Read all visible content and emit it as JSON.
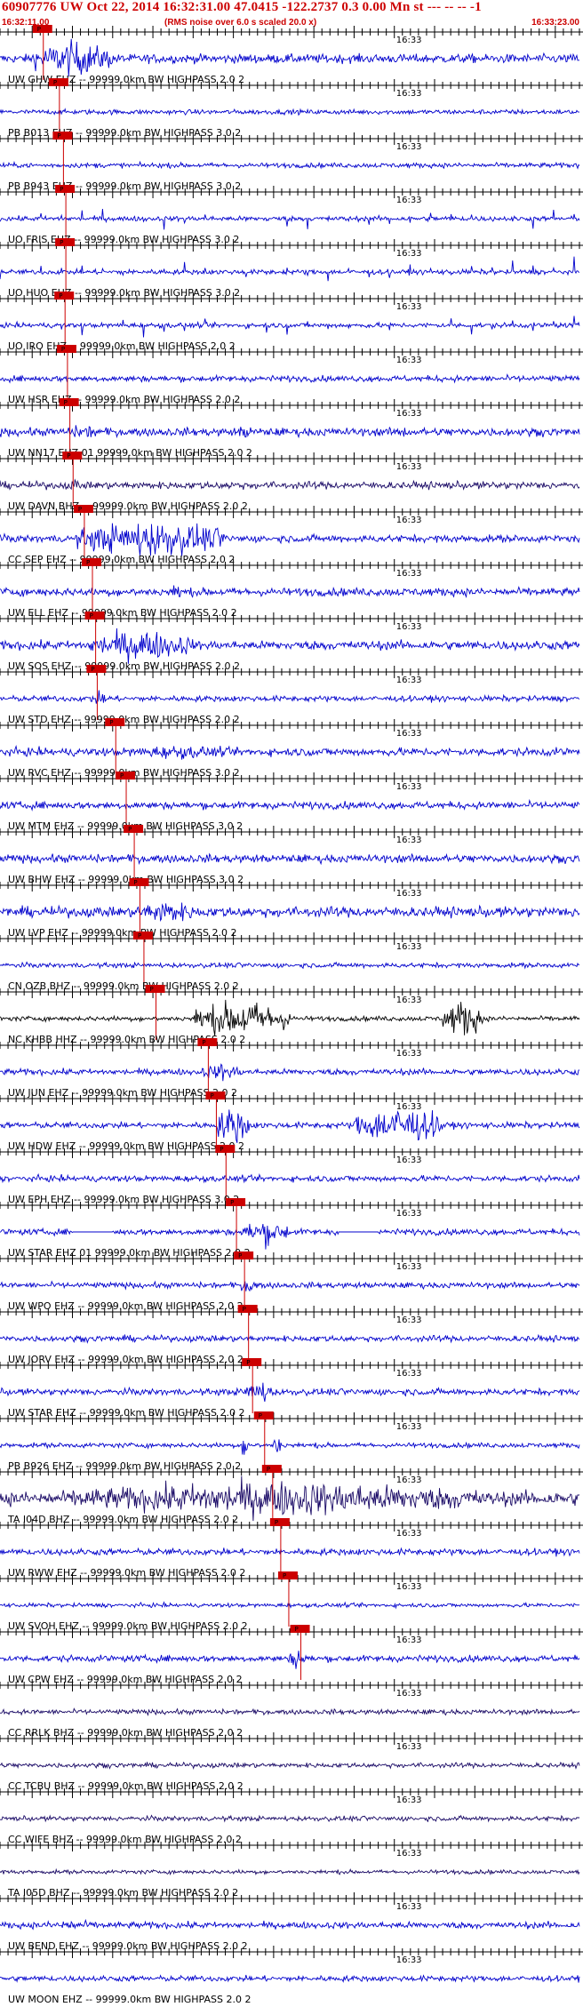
{
  "header": {
    "title": "60907776 UW Oct 22, 2014 16:32:31.00   47.0415 -122.2737  0.3 0.00 Mn st --- -- --   -1",
    "time_left": "16:32:11.00",
    "note": "(RMS noise over 6.0 s scaled 20.0 x)",
    "time_right": "16:33:23.00"
  },
  "chart_data": {
    "type": "line",
    "title": "60907776 UW Oct 22, 2014 16:32:31.00   47.0415 -122.2737  0.3 0.00 Mn st --- -- --   -1",
    "x_start": "16:32:11.00",
    "x_end": "16:33:23.00",
    "x_minor_tick_s": 1,
    "x_major_tick_s": 5,
    "minute_mark": "16:33",
    "minute_mark_offset_s": 49,
    "pick_label": "P",
    "colors": {
      "trace": "#0000cc",
      "trace_alt": "#000000",
      "trace_dark": "#1a0a66",
      "pick": "#cc0000",
      "axis": "#000000"
    },
    "traces": [
      {
        "label": "UW GHW EHZ -- 99999.0km BW  HIGHPASS  2.0  2",
        "pick_s": 4.5,
        "amp": 0.22,
        "event": [
          [
            4,
            14,
            0.9
          ]
        ],
        "color": "#0000cc"
      },
      {
        "label": "PB B013 EHZ -- 99999.0km BW  HIGHPASS  3.0  2",
        "pick_s": 6.5,
        "amp": 0.12,
        "event": [],
        "color": "#0000cc"
      },
      {
        "label": "PB B943 EHZ -- 99999.0km BW  HIGHPASS  3.0  2",
        "pick_s": 7.0,
        "amp": 0.12,
        "event": [],
        "color": "#0000cc"
      },
      {
        "label": "UO FRIS EHZ -- 99999.0km BW  HIGHPASS  3.0  2",
        "pick_s": 7.3,
        "amp": 0.12,
        "event": [],
        "spiky": true,
        "color": "#0000cc"
      },
      {
        "label": "UO HUO EHZ -- 99999.0km BW  HIGHPASS  3.0  2",
        "pick_s": 7.3,
        "amp": 0.12,
        "event": [],
        "spiky": true,
        "color": "#0000cc"
      },
      {
        "label": "UO IRO EHZ -- 99999.0km BW  HIGHPASS  2.0  2",
        "pick_s": 7.2,
        "amp": 0.12,
        "event": [],
        "spiky": true,
        "color": "#0000cc"
      },
      {
        "label": "UW HSR EHZ -- 99999.0km BW  HIGHPASS  2.0  2",
        "pick_s": 7.5,
        "amp": 0.15,
        "event": [],
        "color": "#0000cc"
      },
      {
        "label": "UW NN17 EHZ 01 99999.0km BW  HIGHPASS  2.0  2",
        "pick_s": 7.8,
        "amp": 0.2,
        "event": [
          [
            7,
            14,
            0.35
          ],
          [
            29,
            32,
            0.35
          ],
          [
            49,
            51,
            0.3
          ]
        ],
        "color": "#0000cc"
      },
      {
        "label": "UW DAVN BHZ -- 99999.0km BW  HIGHPASS  2.0  2",
        "pick_s": 8.2,
        "amp": 0.18,
        "event": [
          [
            8.5,
            10,
            0.35
          ],
          [
            28,
            30,
            0.3
          ]
        ],
        "color": "#1a0a66"
      },
      {
        "label": "CC SEP EHZ -- 99999.0km BW  HIGHPASS  2.0  2",
        "pick_s": 9.6,
        "amp": 0.18,
        "event": [
          [
            9.5,
            28,
            0.95
          ]
        ],
        "color": "#0000cc"
      },
      {
        "label": "UW ELL EHZ -- 99999.0km BW  HIGHPASS  2.0  2",
        "pick_s": 10.6,
        "amp": 0.2,
        "event": [
          [
            21,
            23,
            0.45
          ]
        ],
        "color": "#0000cc"
      },
      {
        "label": "UW SOS EHZ -- 99999.0km BW  HIGHPASS  2.0  2",
        "pick_s": 11.0,
        "amp": 0.22,
        "event": [
          [
            11,
            24,
            0.8
          ]
        ],
        "color": "#0000cc"
      },
      {
        "label": "UW STD EHZ -- 99999.0km BW  HIGHPASS  2.0  2",
        "pick_s": 11.2,
        "amp": 0.14,
        "event": [
          [
            11,
            14,
            0.35
          ]
        ],
        "color": "#0000cc"
      },
      {
        "label": "UW RVC EHZ -- 99999.0km BW  HIGHPASS  3.0  2",
        "pick_s": 13.5,
        "amp": 0.2,
        "event": [
          [
            14,
            30,
            0.35
          ]
        ],
        "color": "#0000cc"
      },
      {
        "label": "UW MTM EHZ -- 99999.0km BW  HIGHPASS  3.0  2",
        "pick_s": 14.8,
        "amp": 0.18,
        "event": [],
        "color": "#0000cc"
      },
      {
        "label": "UW BHW EHZ -- 99999.0km BW  HIGHPASS  3.0  2",
        "pick_s": 15.8,
        "amp": 0.2,
        "event": [],
        "color": "#0000cc"
      },
      {
        "label": "UW LVP EHZ -- 99999.0km BW  HIGHPASS  2.0  2",
        "pick_s": 16.5,
        "amp": 0.25,
        "event": [
          [
            17,
            24,
            0.65
          ]
        ],
        "color": "#0000cc"
      },
      {
        "label": "CN OZB BHZ -- 99999.0km BW  HIGHPASS  2.0  2",
        "pick_s": 17.0,
        "amp": 0.12,
        "event": [],
        "color": "#0000cc"
      },
      {
        "label": "NC KHBB HHZ -- 99999.0km BW  HIGHPASS  2.0  2",
        "pick_s": 18.5,
        "amp": 0.12,
        "event": [
          [
            24,
            36,
            0.95
          ],
          [
            55,
            60,
            0.95
          ]
        ],
        "color": "#000000"
      },
      {
        "label": "UW JUN EHZ -- 99999.0km BW  HIGHPASS  2.0  2",
        "pick_s": 25.0,
        "amp": 0.15,
        "event": [
          [
            25,
            30,
            0.45
          ]
        ],
        "color": "#0000cc"
      },
      {
        "label": "UW HDW EHZ -- 99999.0km BW  HIGHPASS  2.0  2",
        "pick_s": 26.0,
        "amp": 0.15,
        "event": [
          [
            27,
            31,
            1.0
          ],
          [
            44,
            55,
            1.0
          ]
        ],
        "color": "#0000cc"
      },
      {
        "label": "UW EPH EHZ -- 99999.0km BW  HIGHPASS  3.0  2",
        "pick_s": 27.2,
        "amp": 0.15,
        "event": [],
        "color": "#0000cc"
      },
      {
        "label": "UW STAR EHZ 01 99999.0km BW  HIGHPASS  2.0  2",
        "pick_s": 28.5,
        "amp": 0.15,
        "event": [
          [
            30,
            36,
            0.65
          ]
        ],
        "gaps": [
          [
            9,
            14
          ],
          [
            42,
            47
          ]
        ],
        "color": "#0000cc"
      },
      {
        "label": "UW WPO EHZ -- 99999.0km BW  HIGHPASS  2.0  2",
        "pick_s": 29.5,
        "amp": 0.14,
        "event": [
          [
            30,
            32,
            0.45
          ]
        ],
        "color": "#0000cc"
      },
      {
        "label": "UW JORV EHZ -- 99999.0km BW  HIGHPASS  2.0  2",
        "pick_s": 30.0,
        "amp": 0.15,
        "event": [],
        "color": "#0000cc"
      },
      {
        "label": "UW STAR EHZ -- 99999.0km BW  HIGHPASS  2.0  2",
        "pick_s": 30.5,
        "amp": 0.16,
        "event": [
          [
            30,
            34,
            0.65
          ]
        ],
        "color": "#0000cc"
      },
      {
        "label": "PB B926 EHZ -- 99999.0km BW  HIGHPASS  2.0  2",
        "pick_s": 32.0,
        "amp": 0.12,
        "event": [
          [
            30,
            31,
            0.7
          ],
          [
            34,
            35,
            0.7
          ]
        ],
        "color": "#0000cc"
      },
      {
        "label": "TA I04D BHZ -- 99999.0km BW  HIGHPASS  2.0  2",
        "pick_s": 33.0,
        "amp": 0.35,
        "event": [
          [
            9,
            60,
            0.9
          ]
        ],
        "color": "#1a0a66"
      },
      {
        "label": "UW RWW EHZ -- 99999.0km BW  HIGHPASS  2.0  2",
        "pick_s": 34.0,
        "amp": 0.16,
        "event": [],
        "color": "#0000cc"
      },
      {
        "label": "UW SVOH EHZ -- 99999.0km BW  HIGHPASS  2.0  2",
        "pick_s": 35.0,
        "amp": 0.1,
        "event": [],
        "color": "#0000cc"
      },
      {
        "label": "UW CPW EHZ -- 99999.0km BW  HIGHPASS  2.0  2",
        "pick_s": 36.5,
        "amp": 0.16,
        "event": [
          [
            36,
            38,
            0.6
          ]
        ],
        "color": "#0000cc"
      },
      {
        "label": "CC RRLK BHZ -- 99999.0km BW  HIGHPASS  2.0  2",
        "pick_s": null,
        "amp": 0.12,
        "event": [],
        "color": "#1a0a66"
      },
      {
        "label": "CC TCBU BHZ -- 99999.0km BW  HIGHPASS  2.0  2",
        "pick_s": null,
        "amp": 0.12,
        "event": [],
        "color": "#1a0a66"
      },
      {
        "label": "CC WIFE BHZ -- 99999.0km BW  HIGHPASS  2.0  2",
        "pick_s": null,
        "amp": 0.12,
        "event": [],
        "color": "#1a0a66"
      },
      {
        "label": "TA I05D BHZ -- 99999.0km BW  HIGHPASS  2.0  2",
        "pick_s": null,
        "amp": 0.1,
        "event": [],
        "color": "#1a0a66"
      },
      {
        "label": "UW BEND EHZ -- 99999.0km BW  HIGHPASS  2.0  2",
        "pick_s": null,
        "amp": 0.16,
        "event": [
          [
            5,
            12,
            0.3
          ]
        ],
        "color": "#0000cc"
      },
      {
        "label": "UW MOON EHZ -- 99999.0km BW  HIGHPASS  2.0  2",
        "pick_s": null,
        "amp": 0.14,
        "event": [],
        "color": "#0000cc"
      }
    ]
  }
}
